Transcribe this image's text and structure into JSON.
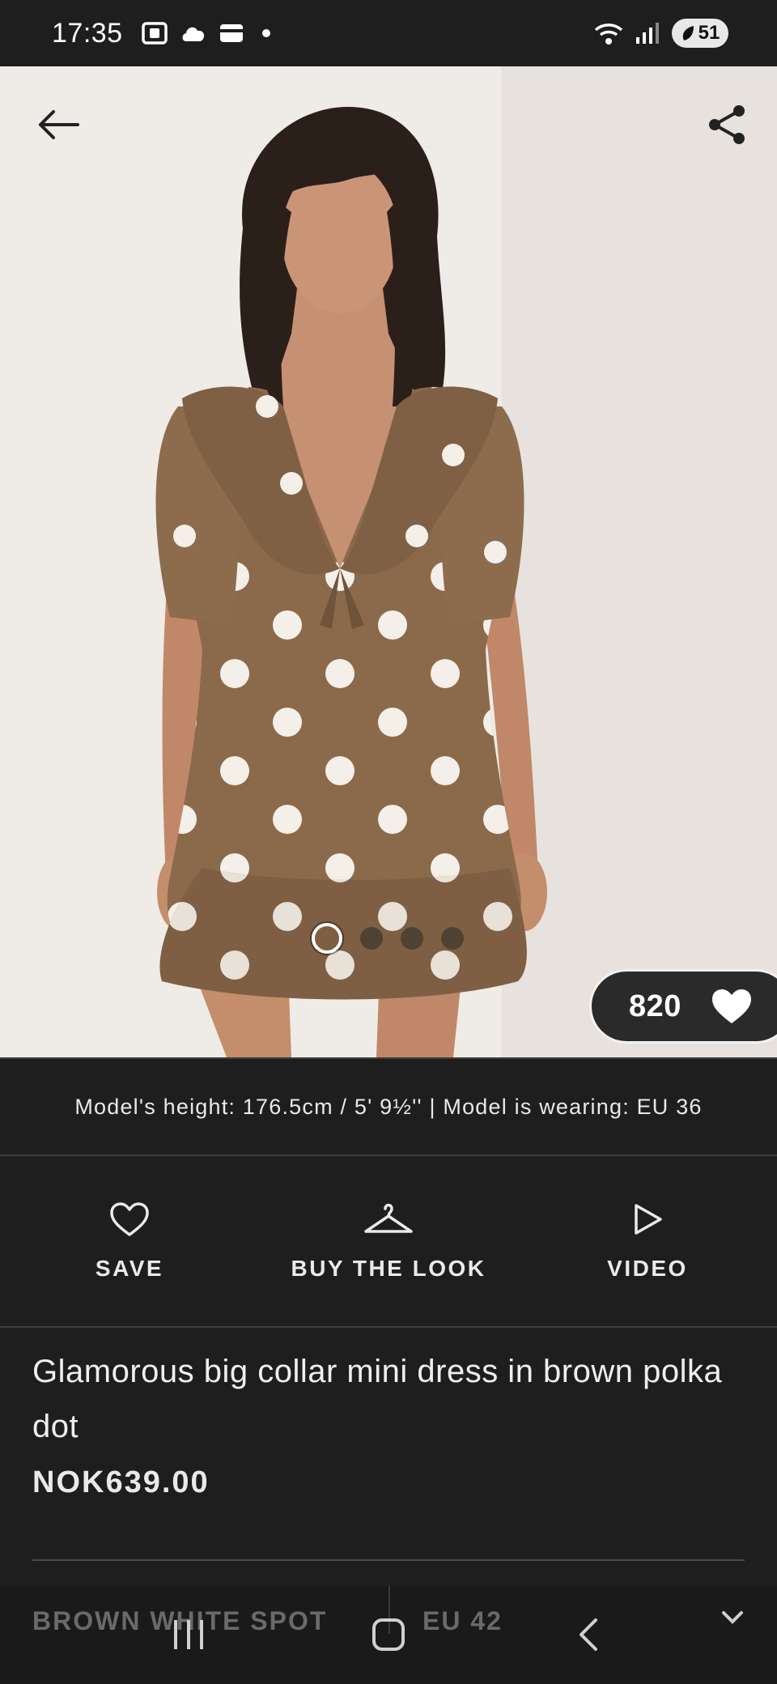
{
  "status_bar": {
    "time": "17:35",
    "battery": "51"
  },
  "hero": {
    "image_count": 4,
    "active_index": 0,
    "likes": "820"
  },
  "model_info": "Model's height: 176.5cm / 5' 9½'' | Model is wearing: EU 36",
  "actions": [
    {
      "label": "SAVE",
      "icon": "heart-outline-icon"
    },
    {
      "label": "BUY THE LOOK",
      "icon": "hanger-icon"
    },
    {
      "label": "VIDEO",
      "icon": "play-icon"
    }
  ],
  "product": {
    "title": "Glamorous big collar mini dress in brown polka dot",
    "price": "NOK639.00"
  },
  "options": {
    "colour": "BROWN WHITE SPOT",
    "size": "EU 42"
  },
  "colors": {
    "background": "#1e1e1f",
    "dress": "#8b6a4b",
    "accent": "#ffffff"
  }
}
